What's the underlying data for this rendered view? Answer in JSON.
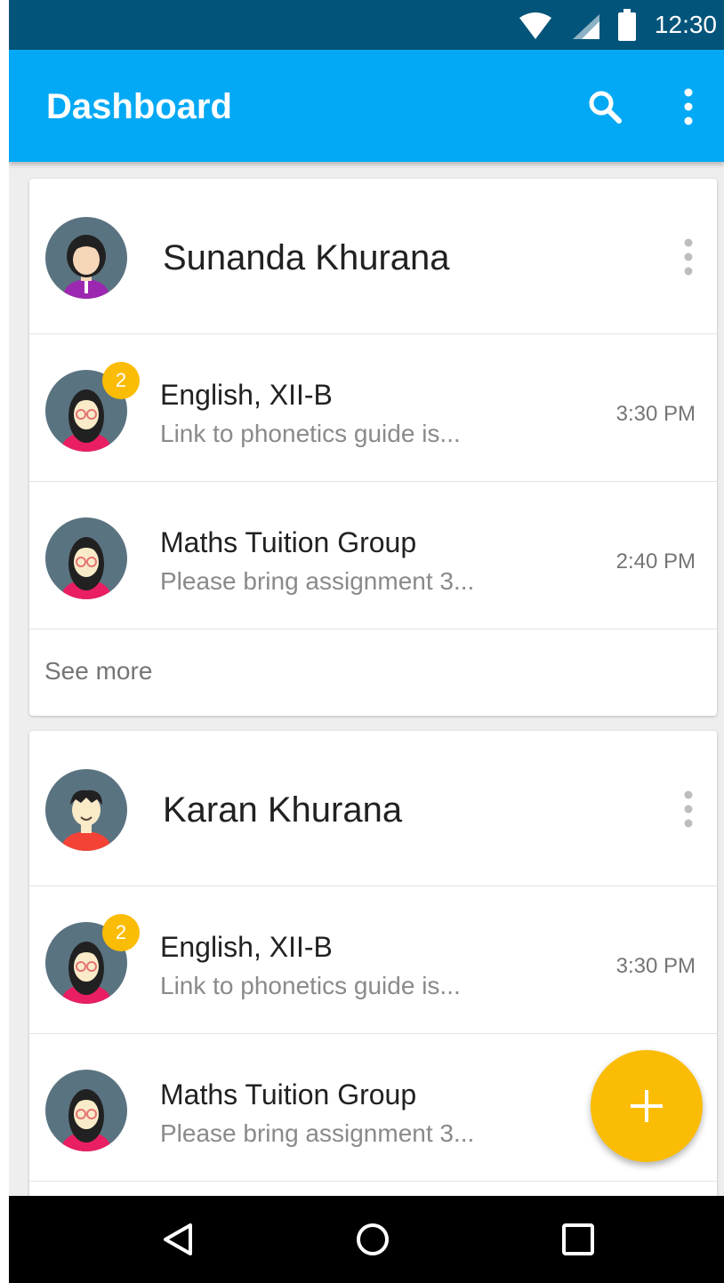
{
  "status_bar": {
    "time": "12:30"
  },
  "app_bar": {
    "title": "Dashboard"
  },
  "cards": [
    {
      "person_name": "Sunanda Khurana",
      "rows": [
        {
          "title": "English, XII-B",
          "preview": "Link to phonetics guide is...",
          "time": "3:30 PM",
          "badge": "2"
        },
        {
          "title": "Maths Tuition Group",
          "preview": "Please bring assignment 3...",
          "time": "2:40 PM"
        }
      ],
      "see_more": "See more"
    },
    {
      "person_name": "Karan Khurana",
      "rows": [
        {
          "title": "English, XII-B",
          "preview": "Link to phonetics guide is...",
          "time": "3:30 PM",
          "badge": "2"
        },
        {
          "title": "Maths Tuition Group",
          "preview": "Please bring assignment 3..."
        }
      ]
    }
  ],
  "colors": {
    "status_bar": "#02547a",
    "app_bar": "#03a9f4",
    "accent": "#fbbc05",
    "avatar_bg": "#5a7381"
  },
  "icons": {
    "app_bar": [
      "search-icon",
      "overflow-menu-icon"
    ],
    "status_bar": [
      "wifi-icon",
      "signal-icon",
      "battery-icon"
    ],
    "nav_bar": [
      "back-icon",
      "home-icon",
      "recents-icon"
    ],
    "fab": "plus-icon"
  }
}
